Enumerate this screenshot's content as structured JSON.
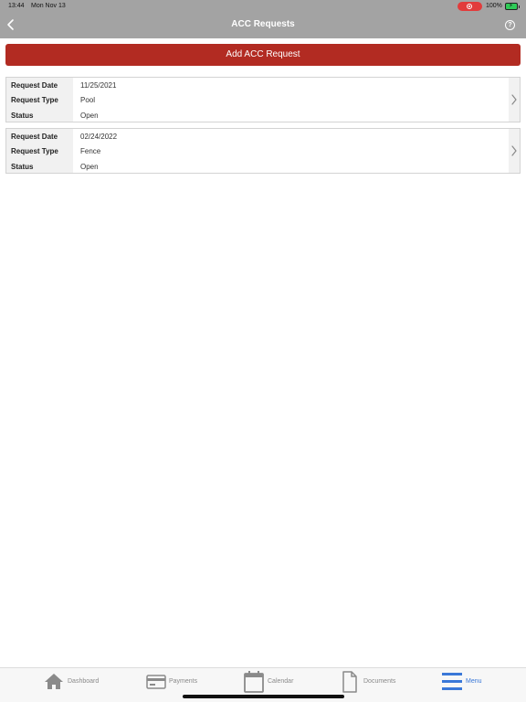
{
  "status_bar": {
    "time": "13:44",
    "date": "Mon Nov 13",
    "battery": "100%"
  },
  "header": {
    "title": "ACC Requests",
    "help": "?"
  },
  "actions": {
    "add_label": "Add ACC Request"
  },
  "requests": [
    {
      "rows": [
        {
          "label": "Request Date",
          "value": "11/25/2021"
        },
        {
          "label": "Request Type",
          "value": "Pool"
        },
        {
          "label": "Status",
          "value": "Open"
        }
      ]
    },
    {
      "rows": [
        {
          "label": "Request Date",
          "value": "02/24/2022"
        },
        {
          "label": "Request Type",
          "value": "Fence"
        },
        {
          "label": "Status",
          "value": "Open"
        }
      ]
    }
  ],
  "tabs": [
    {
      "label": "Dashboard",
      "icon": "home-icon"
    },
    {
      "label": "Payments",
      "icon": "credit-card-icon"
    },
    {
      "label": "Calendar",
      "icon": "calendar-icon"
    },
    {
      "label": "Documents",
      "icon": "document-icon"
    },
    {
      "label": "Menu",
      "icon": "menu-icon",
      "active": true
    }
  ],
  "colors": {
    "header": "#a3a3a3",
    "accent": "#b22b22",
    "active_tab": "#3a78d8"
  }
}
